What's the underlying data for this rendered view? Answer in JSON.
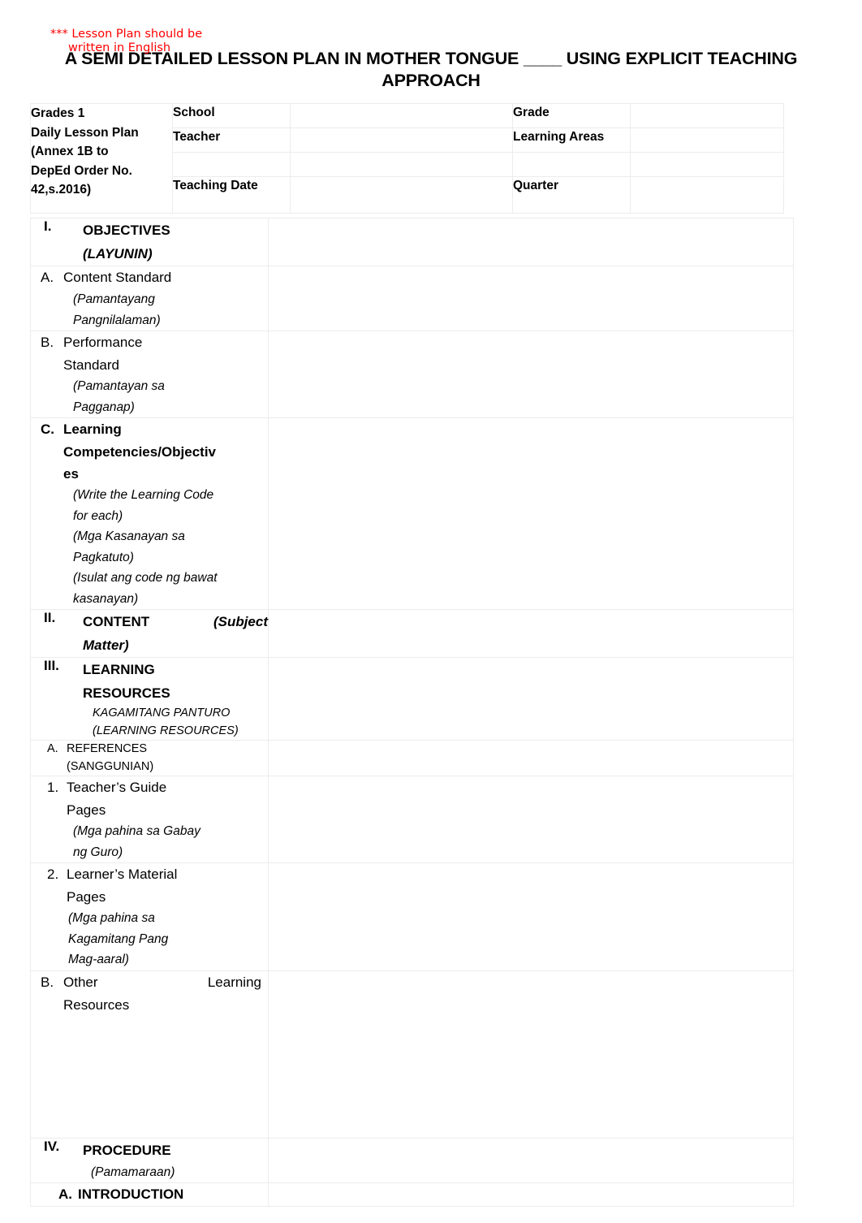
{
  "annotation": {
    "line1": "*** Lesson Plan should be",
    "line2": "written in English",
    "color": "#ff0000"
  },
  "title": "A SEMI DETAILED LESSON PLAN IN MOTHER TONGUE ____ USING EXPLICIT TEACHING APPROACH",
  "info_table": {
    "grades_label": "Grades 1 Daily Lesson Plan (Annex 1B to DepEd Order No. 42,s.2016)",
    "grades_lines": [
      "Grades 1",
      "Daily Lesson Plan",
      "(Annex 1B to",
      "DepEd Order No.",
      "42,s.2016)"
    ],
    "rows": [
      {
        "left_label": "School",
        "left_value": "",
        "right_label": "Grade",
        "right_value": ""
      },
      {
        "left_label": "Teacher",
        "left_value": "",
        "right_label": "Learning Areas",
        "right_value": ""
      },
      {
        "left_label": "Teaching Date",
        "left_value": "",
        "right_label": "Quarter",
        "right_value": ""
      }
    ]
  },
  "body": {
    "objectives": {
      "numeral": "I.",
      "heading": "OBJECTIVES",
      "heading_translation": "(LAYUNIN)",
      "value": ""
    },
    "content_standard": {
      "letter": "A.",
      "heading": "Content Standard",
      "translation_lines": [
        "(Pamantayang",
        "Pangnilalaman)"
      ],
      "value": ""
    },
    "performance_standard": {
      "letter": "B.",
      "heading_lines": [
        "Performance",
        "Standard"
      ],
      "translation_lines": [
        "(Pamantayan sa",
        "Pagganap)"
      ],
      "value": ""
    },
    "learning_competencies": {
      "letter": "C.",
      "heading_lines": [
        "Learning",
        "Competencies/Objectiv",
        "es"
      ],
      "translation_lines": [
        "(Write the Learning Code",
        "for each)",
        "(Mga Kasanayan sa",
        "Pagkatuto)",
        "(Isulat ang code ng bawat",
        "kasanayan)"
      ],
      "value": ""
    },
    "content": {
      "numeral": "II.",
      "heading": "CONTENT",
      "heading_translation_lines": [
        "(Subject",
        "Matter)"
      ],
      "value": ""
    },
    "learning_resources": {
      "numeral": "III.",
      "heading_lines": [
        "LEARNING",
        "RESOURCES"
      ],
      "translation_lines": [
        "KAGAMITANG PANTURO",
        "(LEARNING RESOURCES)"
      ],
      "value": ""
    },
    "references": {
      "letter": "A.",
      "heading": "REFERENCES",
      "translation": "(SANGGUNIAN)",
      "value": ""
    },
    "teachers_guide": {
      "number": "1.",
      "heading_lines": [
        "Teacher’s Guide",
        "Pages"
      ],
      "translation_lines": [
        "(Mga pahina sa Gabay",
        "ng Guro)"
      ],
      "value": ""
    },
    "learners_material": {
      "number": "2.",
      "heading_lines": [
        "Learner’s Material",
        "Pages"
      ],
      "translation_lines": [
        "(Mga pahina sa",
        "Kagamitang Pang",
        "Mag-aaral)"
      ],
      "value": ""
    },
    "other_learning_resources": {
      "letter": "B.",
      "heading_word1": "Other",
      "heading_word2": "Learning",
      "heading_line2": "Resources",
      "value": ""
    },
    "procedure": {
      "numeral": "IV.",
      "heading": "PROCEDURE",
      "translation": "(Pamamaraan)",
      "value": ""
    },
    "introduction": {
      "letter": "A.",
      "heading": "INTRODUCTION",
      "value": ""
    }
  }
}
